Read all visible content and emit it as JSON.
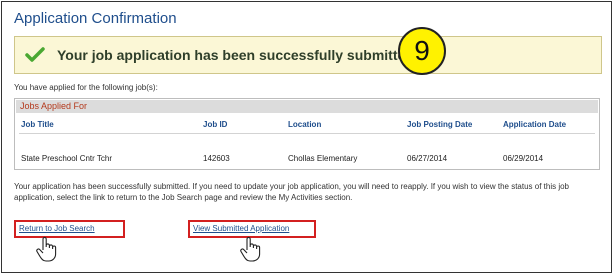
{
  "page": {
    "title": "Application Confirmation"
  },
  "banner": {
    "message": "Your job application has been successfully submitted.",
    "step_number": "9",
    "icons": {
      "check": "check-icon"
    },
    "colors": {
      "background": "#fbf7d6",
      "check": "#4aa832",
      "badge": "#fff200"
    }
  },
  "applied": {
    "intro": "You have applied for the following job(s):",
    "section_title": "Jobs Applied For",
    "columns": [
      "Job Title",
      "Job ID",
      "Location",
      "Job Posting Date",
      "Application Date"
    ],
    "rows": [
      [
        "State Preschool Cntr Tchr",
        "142603",
        "Chollas Elementary",
        "06/27/2014",
        "06/29/2014"
      ]
    ]
  },
  "note": "Your application has been successfully submitted.  If you need to update your job application, you will need to reapply.  If you wish to view the status of this job application, select the link to return to the Job Search page and review the My Activities section.",
  "links": {
    "return_to_search": "Return to Job Search",
    "view_application": "View Submitted Application"
  },
  "cursor_icon": "hand-pointer-icon"
}
